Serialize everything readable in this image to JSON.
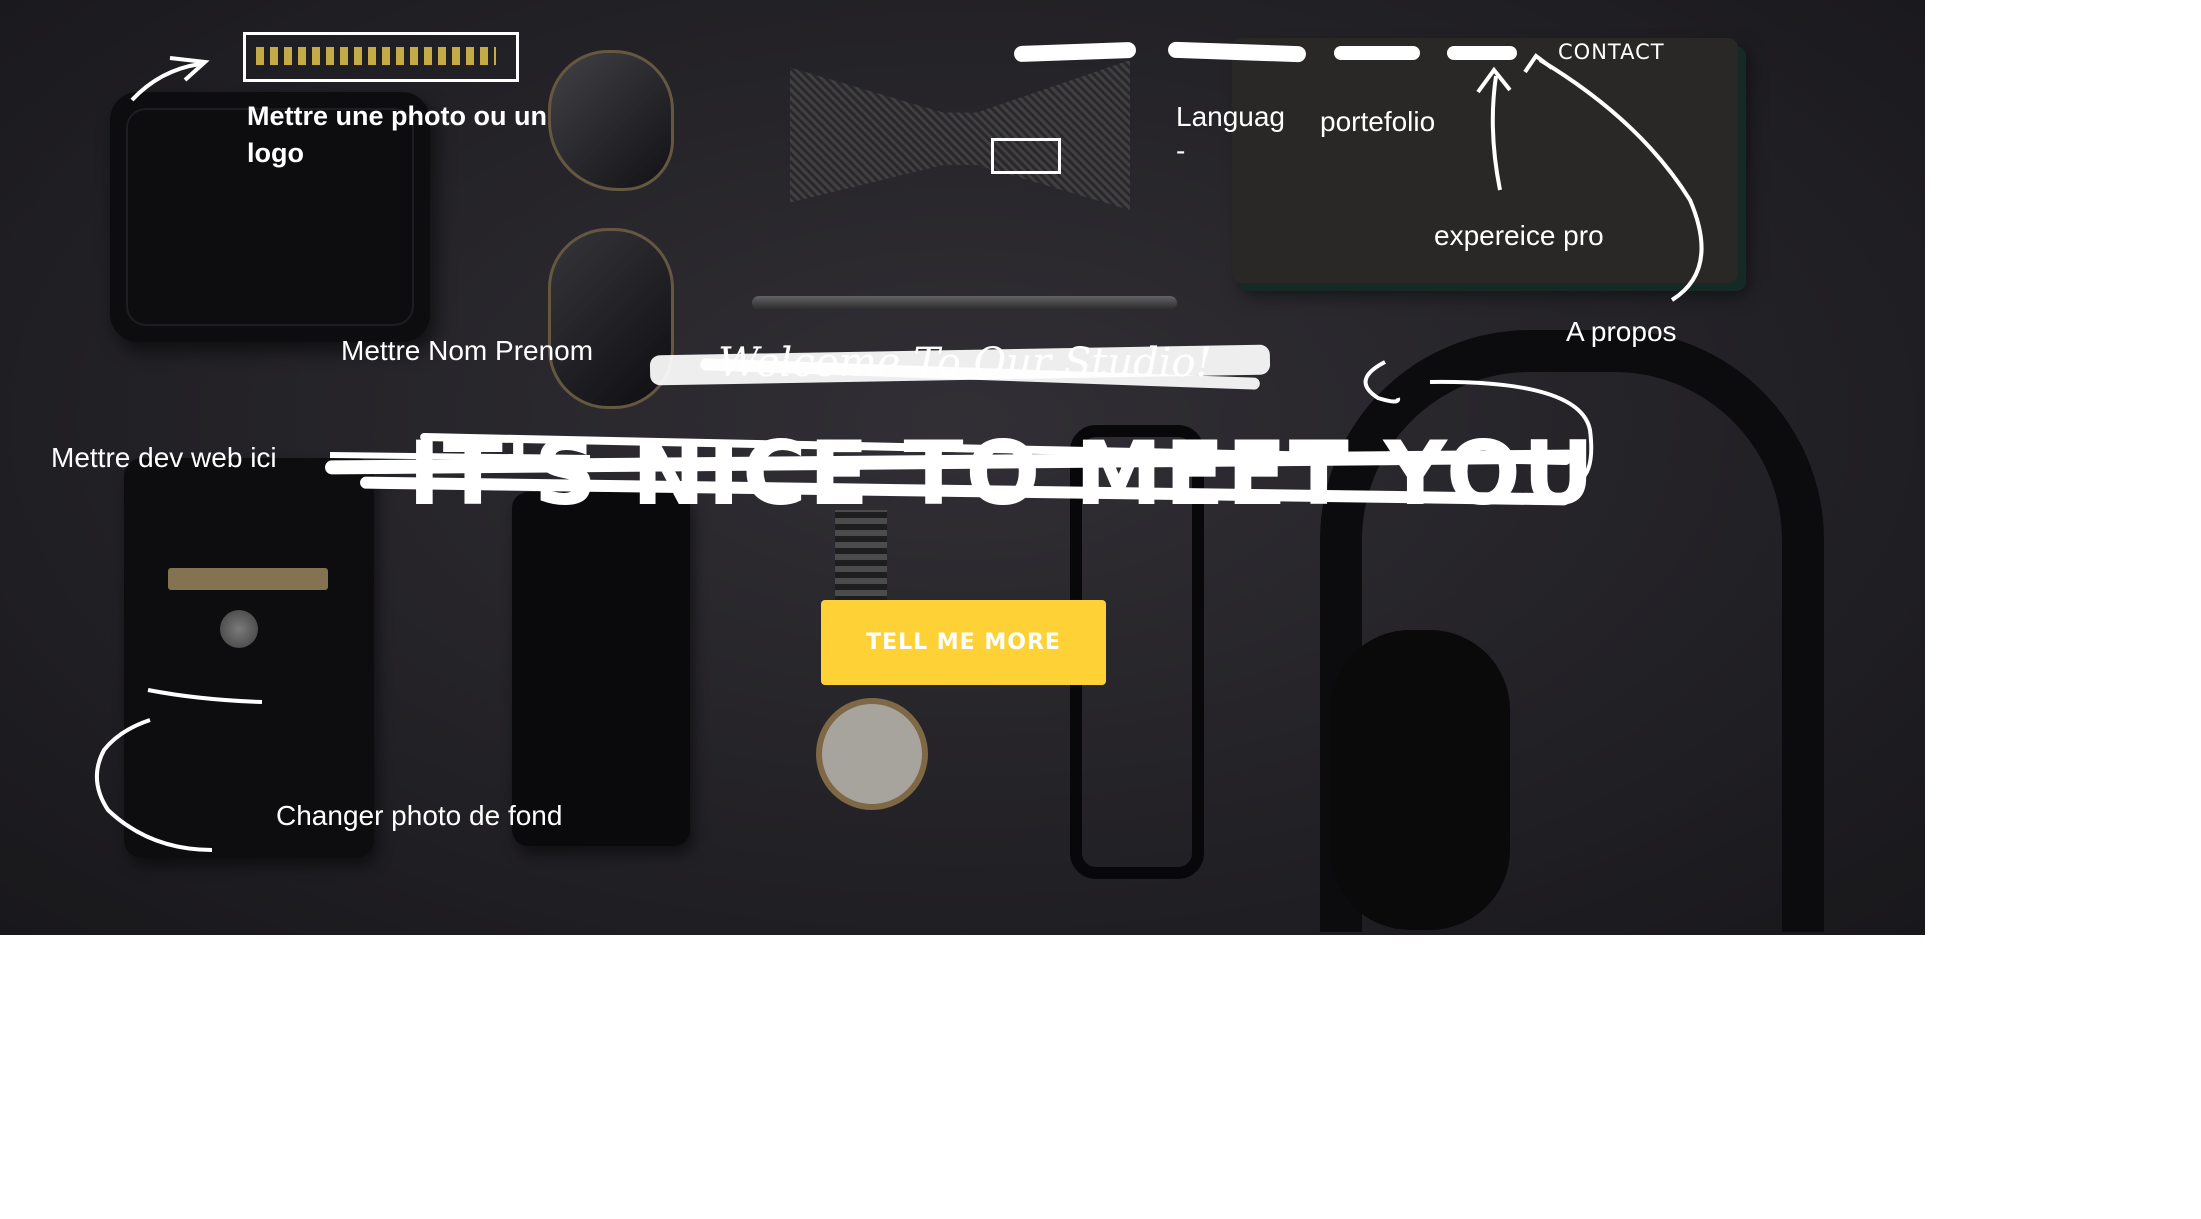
{
  "nav": {
    "items": [
      "",
      "",
      "",
      "",
      "CONTACT"
    ],
    "contact_label": "CONTACT"
  },
  "annotations": {
    "logo_note": "Mettre une photo ou un logo",
    "langue_note": "Languag\n-",
    "portfolio_note": "portefolio",
    "experience_note": "expereice pro",
    "apropos_note": "A propos",
    "nom_note": "Mettre Nom Prenom",
    "dev_note": "Mettre dev web ici",
    "background_note": "Changer photo de fond"
  },
  "hero": {
    "lead": "Welcome To Our Studio!",
    "title": "IT'S NICE TO MEET YOU",
    "cta_label": "TELL ME MORE"
  },
  "colors": {
    "accent": "#fed136",
    "annotation": "#ffffff",
    "background_dark": "#2e2d32"
  },
  "icons": [
    "arrow-icon"
  ]
}
